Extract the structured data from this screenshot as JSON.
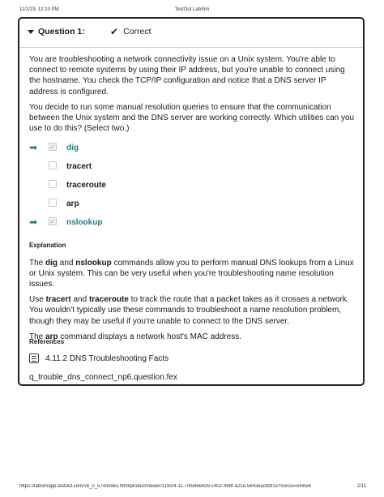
{
  "print_header": {
    "date": "11/2/23, 12:10 PM",
    "title": "TestOut LabSim"
  },
  "question": {
    "label": "Question 1:",
    "status": "Correct",
    "paragraphs": [
      "You are troubleshooting a network connectivity issue on a Unix system. You're able to connect to remote systems by using their IP address, but you're unable to connect using the hostname. You check the TCP/IP configuration and notice that a DNS server IP address is configured.",
      "You decide to run some manual resolution queries to ensure that the communication between the Unix system and the DNS server are working correctly. Which utilities can you use to do this? (Select two.)"
    ],
    "options": [
      {
        "label": "dig",
        "checked": true,
        "correct": true
      },
      {
        "label": "tracert",
        "checked": false,
        "correct": false
      },
      {
        "label": "traceroute",
        "checked": false,
        "correct": false
      },
      {
        "label": "arp",
        "checked": false,
        "correct": false
      },
      {
        "label": "nslookup",
        "checked": true,
        "correct": true
      }
    ]
  },
  "explanation": {
    "title": "Explanation",
    "p1": {
      "a": "The ",
      "b": "dig",
      "c": " and ",
      "d": "nslookup",
      "e": " commands allow you to perform manual DNS lookups from a Linux or Unix system. This can be very useful when you're troubleshooting name resolution issues."
    },
    "p2": {
      "a": "Use ",
      "b": "tracert",
      "c": " and ",
      "d": "traceroute",
      "e": " to track the route that a packet takes as it crosses a network. You wouldn't typically use these commands to troubleshoot a name resolution problem, though they may be useful if you're unable to connect to the DNS server."
    },
    "p3": {
      "a": "The ",
      "b": "arp",
      "c": " command displays a network host's MAC address."
    }
  },
  "references": {
    "title": "References",
    "link": "4.11.2 DNS Troubleshooting Facts",
    "file": "q_trouble_dns_connect_np6.question.fex"
  },
  "print_footer": {
    "url": "https://labsimapp.testout.com/v6_0_574/index.html/productviewer/1190/4.11.7/45966439-c402-498f-a21e-5643eac8bf15?nonce=eHiIwImDvvNDOkH…",
    "page": "2/11"
  }
}
